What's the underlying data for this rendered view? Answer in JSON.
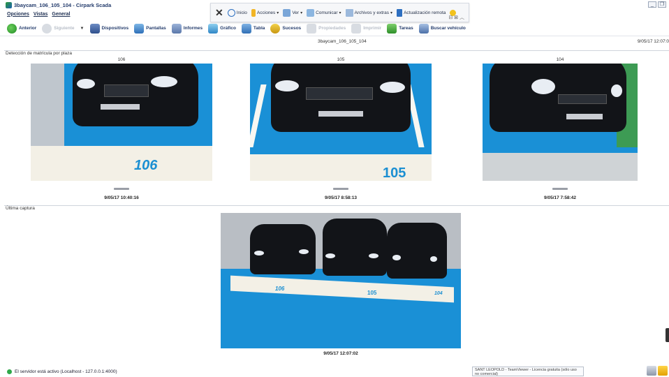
{
  "window": {
    "title": "3baycam_106_105_104 - Cirpark Scada"
  },
  "menu": {
    "items": [
      "Opciones",
      "Vistas",
      "General"
    ]
  },
  "teamviewer": {
    "items": [
      {
        "label": "Inicio",
        "icon": "home-icon"
      },
      {
        "label": "Acciones",
        "icon": "actions-icon"
      },
      {
        "label": "Ver",
        "icon": "view-icon"
      },
      {
        "label": "Comunicar",
        "icon": "chat-icon"
      },
      {
        "label": "Archivos y extras",
        "icon": "files-icon"
      },
      {
        "label": "Actualización remota",
        "icon": "update-icon"
      }
    ]
  },
  "toolbar": {
    "back": "Anterior",
    "next": "Siguiente",
    "devices": "Dispositivos",
    "screens": "Pantallas",
    "reports": "Informes",
    "graph": "Gráfico",
    "table": "Tabla",
    "events": "Sucesos",
    "properties": "Propiedades",
    "print": "Imprimir",
    "tasks": "Tareas",
    "search": "Buscar vehículo"
  },
  "header": {
    "camera": "3baycam_106_105_104",
    "timestamp": "9/05/17 12:07:0"
  },
  "sections": {
    "detection_title": "Detección de matrícula por plaza",
    "last_title": "Última captura"
  },
  "places": [
    {
      "id": "106",
      "date": "9/05/17 10:40:16",
      "floor": "106"
    },
    {
      "id": "105",
      "date": "9/05/17 8:58:13",
      "floor": "105"
    },
    {
      "id": "104",
      "date": "9/05/17 7:58:42",
      "floor": ""
    }
  ],
  "last_capture": {
    "date": "9/05/17 12:07:02",
    "floor_labels": [
      "106",
      "105",
      "104"
    ]
  },
  "status": {
    "text": "El servidor está activo (Localhost - 127.0.0.1:4000)"
  },
  "license": {
    "text": "SANT LEOPOLD - TeamViewer - Licencia gratuita (sólo uso no comercial)"
  },
  "colors": {
    "floor_blue": "#1a90d6",
    "status_green": "#2fa84a",
    "title_blue": "#243c6c"
  }
}
